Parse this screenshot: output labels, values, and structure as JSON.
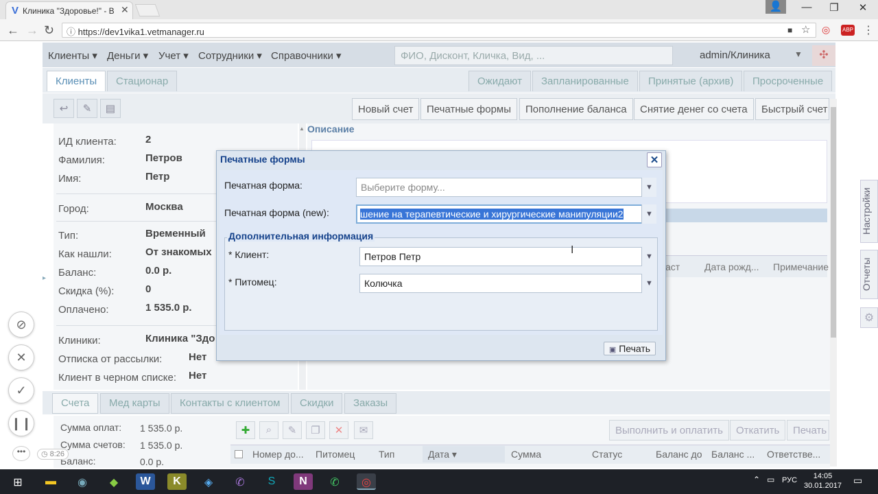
{
  "browser": {
    "tab_title": "Клиника \"Здоровье!\" - В",
    "url": "https://dev1vika1.vetmanager.ru",
    "abp_label": "ABP"
  },
  "menu": {
    "items": [
      "Клиенты",
      "Деньги",
      "Учет",
      "Сотрудники",
      "Справочники"
    ],
    "search_placeholder": "ФИО, Дисконт, Кличка, Вид, ...",
    "user": "admin/Клиника"
  },
  "top_tabs": {
    "left": [
      "Клиенты",
      "Стационар"
    ],
    "right": [
      "Ожидают",
      "Запланированные",
      "Принятые (архив)",
      "Просроченные"
    ]
  },
  "toolbar": {
    "actions": [
      "Новый счет",
      "Печатные формы",
      "Пополнение баланса",
      "Снятие денег со счета",
      "Быстрый счет"
    ]
  },
  "client": {
    "fields": [
      {
        "label": "ИД клиента:",
        "value": "2"
      },
      {
        "label": "Фамилия:",
        "value": "Петров"
      },
      {
        "label": "Имя:",
        "value": "Петр"
      },
      {
        "label": "Город:",
        "value": "Москва"
      },
      {
        "label": "Тип:",
        "value": "Временный"
      },
      {
        "label": "Как нашли:",
        "value": "От знакомых"
      },
      {
        "label": "Баланс:",
        "value": "0.0 р."
      },
      {
        "label": "Скидка (%):",
        "value": "0"
      },
      {
        "label": "Оплачено:",
        "value": "1 535.0 р."
      },
      {
        "label": "Клиники:",
        "value": "Клиника \"Здо"
      },
      {
        "label": "Отписка от рассылки:",
        "value": "Нет"
      },
      {
        "label": "Клиент в черном списке:",
        "value": "Нет"
      }
    ]
  },
  "description": {
    "title": "Описание",
    "grid_headers": [
      "аст",
      "Дата рожд...",
      "Примечание"
    ]
  },
  "bottom_tabs": [
    "Счета",
    "Мед карты",
    "Контакты с клиентом",
    "Скидки",
    "Заказы"
  ],
  "summary": [
    {
      "label": "Сумма оплат:",
      "value": "1 535.0 р."
    },
    {
      "label": "Сумма счетов:",
      "value": "1 535.0 р."
    },
    {
      "label": "Баланс:",
      "value": "0.0 р."
    }
  ],
  "invoice_actions": [
    "Выполнить и оплатить",
    "Откатить",
    "Печать"
  ],
  "invoice_grid_headers": [
    "Номер до...",
    "Питомец",
    "Тип",
    "Дата",
    "Сумма",
    "Статус",
    "Баланс до",
    "Баланс ...",
    "Ответстве..."
  ],
  "side_tabs": [
    "Настройки",
    "Отчеты"
  ],
  "timer": "8:26",
  "dialog": {
    "title": "Печатные формы",
    "form_label": "Печатная форма:",
    "form_placeholder": "Выберите форму...",
    "form_new_label": "Печатная форма (new):",
    "form_new_value": "шение на терапевтические и хирургические манипуляции2",
    "section": "Дополнительная информация",
    "client_label": "* Клиент:",
    "client_value": "Петров Петр",
    "pet_label": "* Питомец:",
    "pet_value": "Колючка",
    "print_button": "Печать"
  },
  "taskbar": {
    "lang": "РУС",
    "time": "14:05",
    "date": "30.01.2017"
  }
}
